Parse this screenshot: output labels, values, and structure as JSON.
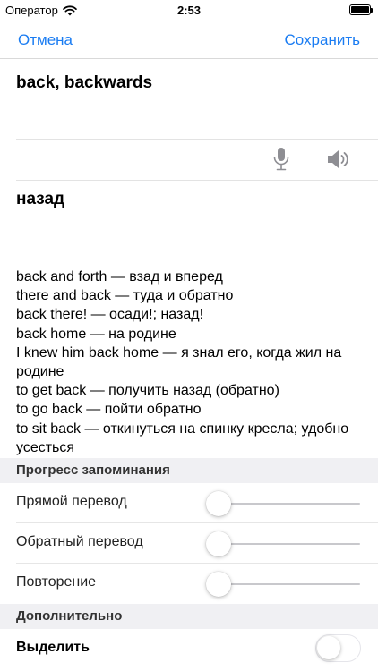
{
  "status_bar": {
    "carrier": "Оператор",
    "time": "2:53",
    "icons": [
      "wifi-icon",
      "battery-icon"
    ]
  },
  "nav": {
    "cancel_label": "Отмена",
    "save_label": "Сохранить",
    "accent_color": "#1a7cf2"
  },
  "word": {
    "text": "back, backwards",
    "translation": "назад",
    "icons": [
      "microphone-icon",
      "speaker-icon"
    ]
  },
  "examples": [
    "back and forth — взад и вперед",
    "there and back — туда и обратно",
    "back there! — осади!; назад!",
    "back home — на родине",
    "I knew him back home — я знал его, когда жил на родине",
    "to get back — получить назад (обратно)",
    "to go back — пойти обратно",
    "to sit back — откинуться на спинку кресла; удобно усесться"
  ],
  "progress_section": {
    "title": "Прогресс запоминания",
    "rows": [
      {
        "label": "Прямой перевод",
        "value": 0
      },
      {
        "label": "Обратный перевод",
        "value": 0
      },
      {
        "label": "Повторение",
        "value": 0
      }
    ]
  },
  "extra_section": {
    "title": "Дополнительно",
    "highlight_label": "Выделить",
    "highlight_on": false
  }
}
